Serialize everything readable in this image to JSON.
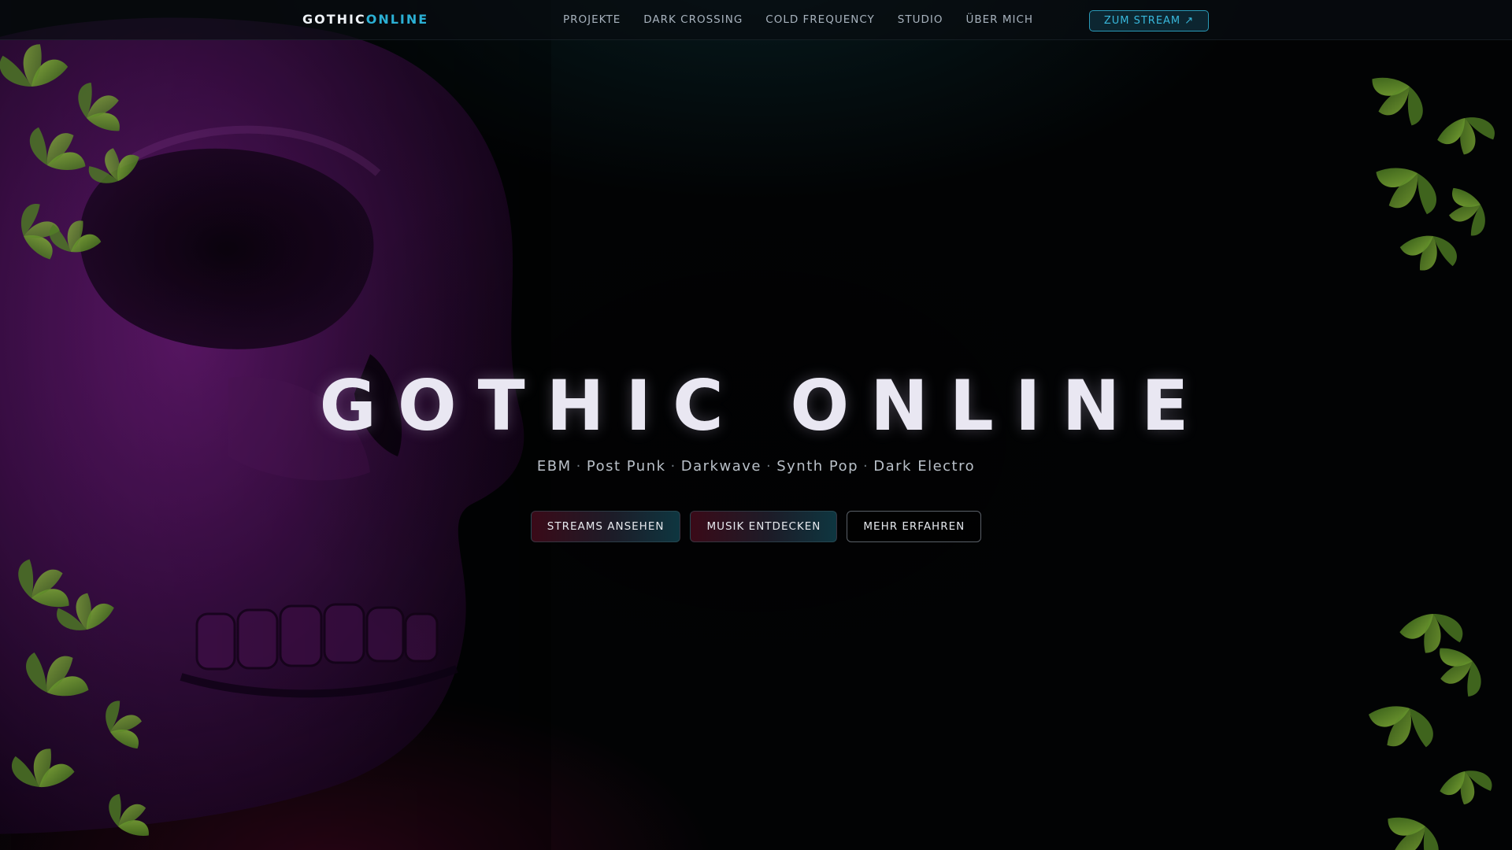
{
  "nav": {
    "brand_part1": "GOTHIC",
    "brand_part2": "ONLINE",
    "links": [
      "PROJEKTE",
      "DARK CROSSING",
      "COLD FREQUENCY",
      "STUDIO",
      "ÜBER MICH"
    ],
    "cta_label": "ZUM STREAM ↗"
  },
  "hero": {
    "title": "GOTHIC ONLINE",
    "genres": [
      "EBM",
      "Post Punk",
      "Darkwave",
      "Synth Pop",
      "Dark Electro"
    ],
    "genre_separator": "·",
    "buttons": [
      "STREAMS ANSEHEN",
      "MUSIK ENTDECKEN",
      "MEHR ERFAHREN"
    ]
  },
  "colors": {
    "accent": "#2bb0d4",
    "skull": "#3a0a44",
    "leaf": "#5e8c2a",
    "background": "#020304"
  },
  "art": {
    "background_image": "purple-skull-illustration",
    "decor": "green-ivy-leaves"
  }
}
